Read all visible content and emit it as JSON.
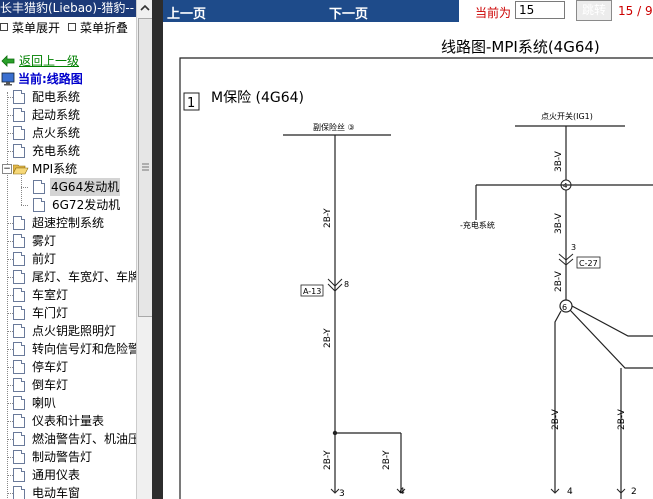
{
  "window": {
    "title": "长丰猎豹(Liebao)-猎豹--"
  },
  "menu": {
    "expand_label": "菜单展开",
    "collapse_label": "菜单折叠"
  },
  "tree": {
    "back_label": "返回上一级",
    "current_label": "当前:线路图",
    "items": [
      {
        "label": "配电系统"
      },
      {
        "label": "起动系统"
      },
      {
        "label": "点火系统"
      },
      {
        "label": "充电系统"
      },
      {
        "label": "MPI系统"
      },
      {
        "label": "4G64发动机"
      },
      {
        "label": "6G72发动机"
      },
      {
        "label": "超速控制系统"
      },
      {
        "label": "雾灯"
      },
      {
        "label": "前灯"
      },
      {
        "label": "尾灯、车宽灯、车牌"
      },
      {
        "label": "车室灯"
      },
      {
        "label": "车门灯"
      },
      {
        "label": "点火钥匙照明灯"
      },
      {
        "label": "转向信号灯和危险警"
      },
      {
        "label": "停车灯"
      },
      {
        "label": "倒车灯"
      },
      {
        "label": "喇叭"
      },
      {
        "label": "仪表和计量表"
      },
      {
        "label": "燃油警告灯、机油压"
      },
      {
        "label": "制动警告灯"
      },
      {
        "label": "通用仪表"
      },
      {
        "label": "电动车窗"
      }
    ]
  },
  "nav": {
    "prev_label": "上一页",
    "next_label": "下一页",
    "current_label": "当前为",
    "page_value": "15",
    "go_label": "跳转",
    "page_count": "15 / 9"
  },
  "diagram": {
    "heading": "线路图-MPI系统(4G64)",
    "box_number": "1",
    "box_title": "M保险 (4G64)",
    "label_left_top": "副保险丝 ③",
    "label_right_top": "点火开关(IG1)",
    "label_charge": "-充电系统",
    "wire_3bv_1": "3B-V",
    "wire_3bv_2": "3B-V",
    "wire_2by_1": "2B-Y",
    "wire_2by_2": "2B-Y",
    "wire_2by_3": "2B-Y",
    "wire_2by_4": "2B-Y",
    "wire_2bv_1": "2B-V",
    "wire_2bv_2": "2B-V",
    "wire_2bv_3": "2B-V",
    "conn_a13": "A-13",
    "conn_c27": "C-27",
    "pin_8": "8",
    "pin_3": "3",
    "node_4": "4",
    "node_6": "6",
    "bottom_3": "3",
    "bottom_4": "4",
    "bottom_4b": "4",
    "bottom_2": "2"
  }
}
